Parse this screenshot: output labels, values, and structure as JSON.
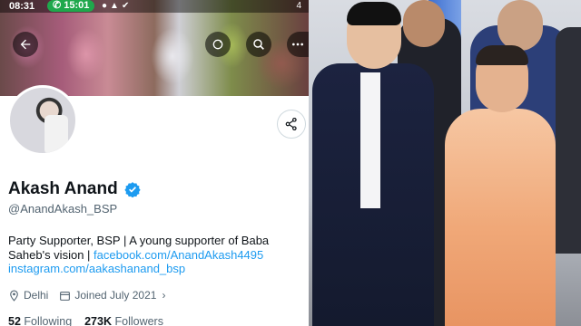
{
  "status_bar": {
    "time": "08:31",
    "call_time": "15:01",
    "right_text": "4"
  },
  "profile": {
    "display_name": "Akash Anand",
    "handle": "@AnandAkash_BSP",
    "bio_text": "Party Supporter, BSP | A young supporter of Baba Saheb's vision |",
    "bio_link_facebook": "facebook.com/AnandAkash4495",
    "bio_link_instagram": "instagram.com/aakashanand_bsp",
    "location": "Delhi",
    "joined": "Joined July 2021",
    "following_count": "52",
    "following_label": "Following",
    "followers_count": "273K",
    "followers_label": "Followers"
  },
  "colors": {
    "accent": "#1d9bf0",
    "text_primary": "#0f1419",
    "text_secondary": "#536471",
    "call_pill": "#1fa84c"
  },
  "icons": {
    "back": "back-arrow-icon",
    "refresh": "refresh-icon",
    "search": "search-icon",
    "more": "more-icon",
    "share": "share-icon",
    "verified": "verified-badge-icon",
    "location": "location-pin-icon",
    "calendar": "calendar-icon"
  }
}
